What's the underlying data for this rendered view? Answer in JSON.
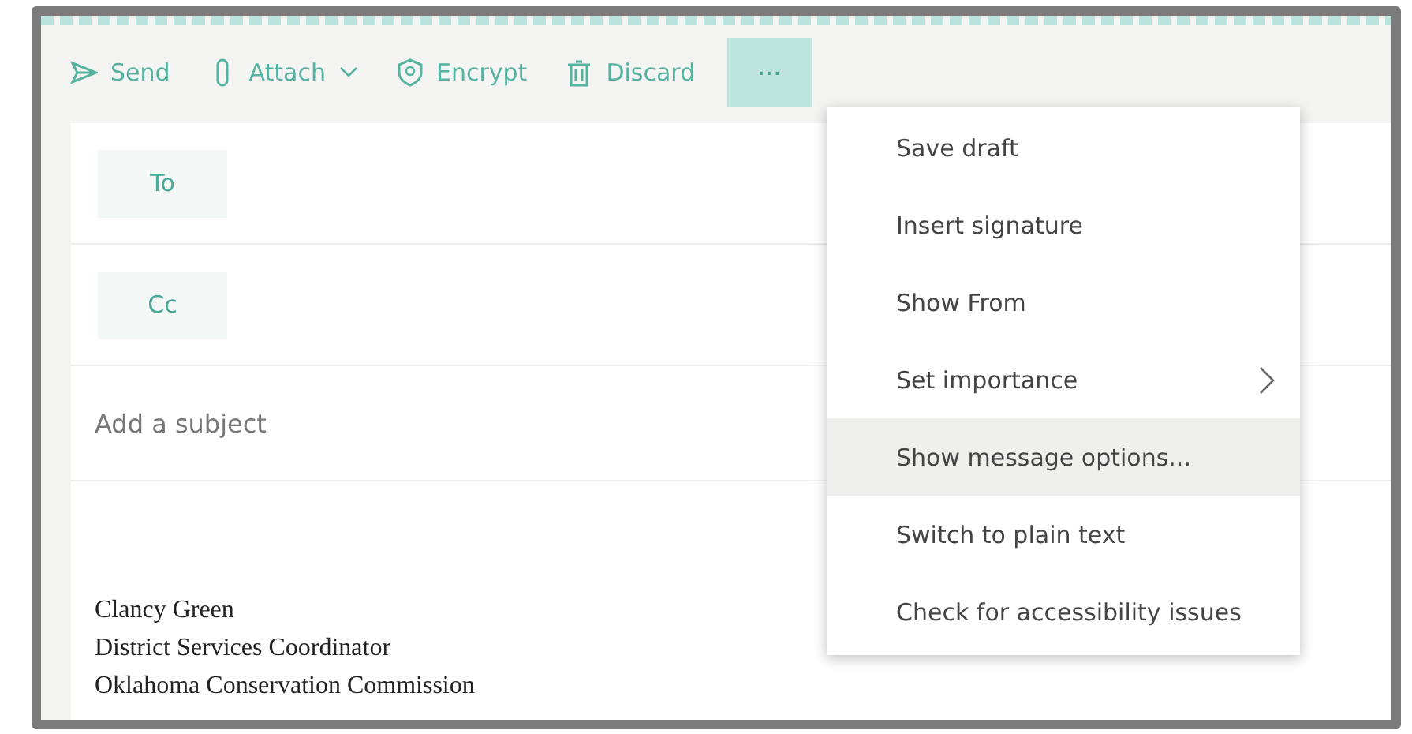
{
  "toolbar": {
    "buttons": [
      {
        "kind": "send",
        "label": "Send",
        "dropdown": false
      },
      {
        "kind": "attach",
        "label": "Attach",
        "dropdown": true
      },
      {
        "kind": "encrypt",
        "label": "Encrypt",
        "dropdown": false
      },
      {
        "kind": "discard",
        "label": "Discard",
        "dropdown": false
      }
    ],
    "more": {
      "label": "···",
      "expanded": true
    }
  },
  "recipients": [
    {
      "label": "To"
    },
    {
      "label": "Cc"
    }
  ],
  "subject": {
    "placeholder": "Add a subject"
  },
  "signature": [
    "Clancy Green",
    "District Services Coordinator",
    "Oklahoma Conservation Commission"
  ],
  "menu": {
    "items": [
      {
        "label": "Save draft",
        "selected": false,
        "submenu": false
      },
      {
        "label": "Insert signature",
        "selected": false,
        "submenu": false
      },
      {
        "label": "Show From",
        "selected": false,
        "submenu": false
      },
      {
        "label": "Set importance",
        "selected": false,
        "submenu": true
      },
      {
        "label": "Show message options...",
        "selected": true,
        "submenu": false
      },
      {
        "label": "Switch to plain text",
        "selected": false,
        "submenu": false
      },
      {
        "label": "Check for accessibility issues",
        "selected": false,
        "submenu": false
      }
    ]
  }
}
